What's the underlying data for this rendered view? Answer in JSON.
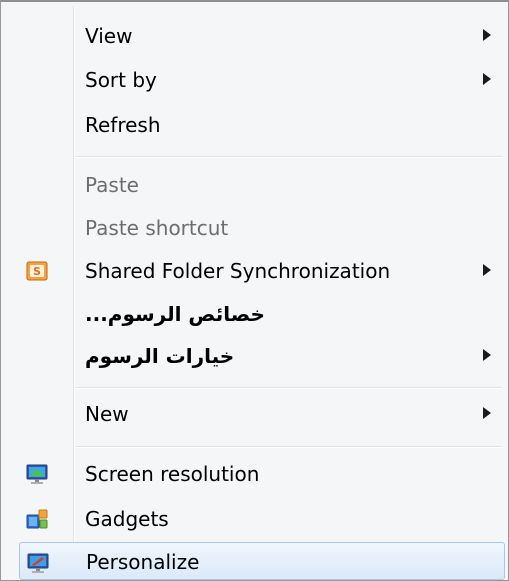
{
  "menu": {
    "items": [
      {
        "label": "View",
        "submenu": true
      },
      {
        "label": "Sort by",
        "submenu": true
      },
      {
        "label": "Refresh",
        "submenu": false
      },
      {
        "label": "Paste",
        "disabled": true
      },
      {
        "label": "Paste shortcut",
        "disabled": true
      },
      {
        "label": "Shared Folder Synchronization",
        "submenu": true,
        "icon": "shared-folder-sync-icon"
      },
      {
        "label": "...خصائص الرسوم",
        "submenu": false
      },
      {
        "label": "خيارات الرسوم",
        "submenu": true
      },
      {
        "label": "New",
        "submenu": true
      },
      {
        "label": "Screen resolution",
        "icon": "screen-resolution-icon"
      },
      {
        "label": "Gadgets",
        "icon": "gadgets-icon"
      },
      {
        "label": "Personalize",
        "icon": "personalize-icon",
        "highlighted": true
      }
    ]
  },
  "colors": {
    "menu_background": "#f5f6f7",
    "disabled_text": "#6d6d6d",
    "highlight_border": "#a8c8ea",
    "highlight_fill": "#dbe9f8"
  }
}
